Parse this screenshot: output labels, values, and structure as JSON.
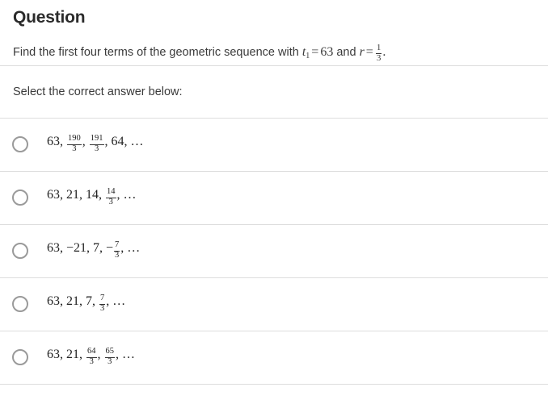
{
  "question": {
    "heading": "Question",
    "prompt_prefix": "Find the first four terms of the geometric sequence with ",
    "var_t": "t",
    "var_t_sub": "1",
    "eq1": "=",
    "t1_value": "63",
    "conjunction": " and ",
    "var_r": "r",
    "eq2": "=",
    "r_numerator": "1",
    "r_denominator": "3",
    "period": "."
  },
  "instruction": {
    "text": "Select the correct answer below:"
  },
  "options": [
    {
      "id": "option-1",
      "selected": false,
      "parts": [
        {
          "type": "text",
          "value": "63, "
        },
        {
          "type": "frac",
          "num": "190",
          "den": "3"
        },
        {
          "type": "text",
          "value": ", "
        },
        {
          "type": "frac",
          "num": "191",
          "den": "3"
        },
        {
          "type": "text",
          "value": ", 64, "
        },
        {
          "type": "ellipsis",
          "value": "…"
        }
      ],
      "plain": "63, 190/3, 191/3, 64, …"
    },
    {
      "id": "option-2",
      "selected": false,
      "parts": [
        {
          "type": "text",
          "value": "63, 21, 14, "
        },
        {
          "type": "frac",
          "num": "14",
          "den": "3"
        },
        {
          "type": "text",
          "value": ", "
        },
        {
          "type": "ellipsis",
          "value": "…"
        }
      ],
      "plain": "63, 21, 14, 14/3, …"
    },
    {
      "id": "option-3",
      "selected": false,
      "parts": [
        {
          "type": "text",
          "value": "63, −21, 7, −"
        },
        {
          "type": "frac",
          "num": "7",
          "den": "3"
        },
        {
          "type": "text",
          "value": ", "
        },
        {
          "type": "ellipsis",
          "value": "…"
        }
      ],
      "plain": "63, −21, 7, −7/3, …"
    },
    {
      "id": "option-4",
      "selected": false,
      "parts": [
        {
          "type": "text",
          "value": "63, 21, 7, "
        },
        {
          "type": "frac",
          "num": "7",
          "den": "3"
        },
        {
          "type": "text",
          "value": ", "
        },
        {
          "type": "ellipsis",
          "value": "…"
        }
      ],
      "plain": "63, 21, 7, 7/3, …"
    },
    {
      "id": "option-5",
      "selected": false,
      "parts": [
        {
          "type": "text",
          "value": "63, 21, "
        },
        {
          "type": "frac",
          "num": "64",
          "den": "3"
        },
        {
          "type": "text",
          "value": ", "
        },
        {
          "type": "frac",
          "num": "65",
          "den": "3"
        },
        {
          "type": "text",
          "value": ", "
        },
        {
          "type": "ellipsis",
          "value": "…"
        }
      ],
      "plain": "63, 21, 64/3, 65/3, …"
    }
  ],
  "colors": {
    "divider": "#dddddd",
    "radio_border": "#9a9a9a",
    "text": "#333333",
    "heading": "#2b2b2b",
    "background": "#ffffff"
  }
}
